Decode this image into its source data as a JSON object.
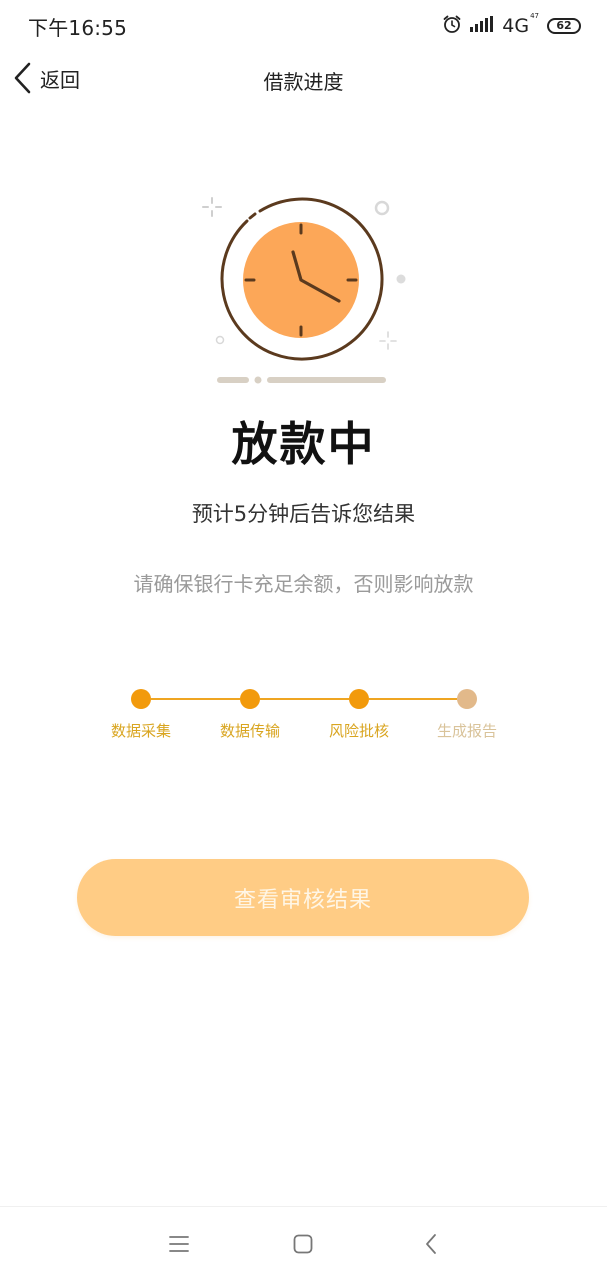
{
  "status_bar": {
    "time": "下午16:55",
    "network": "4G",
    "network_sub": "47",
    "battery": "62"
  },
  "nav": {
    "back_label": "返回",
    "title": "借款进度"
  },
  "status": {
    "title": "放款中",
    "subtitle": "预计5分钟后告诉您结果",
    "hint": "请确保银行卡充足余额，否则影响放款"
  },
  "steps": [
    {
      "label": "数据采集",
      "state": "done"
    },
    {
      "label": "数据传输",
      "state": "done"
    },
    {
      "label": "风险批核",
      "state": "done"
    },
    {
      "label": "生成报告",
      "state": "pending"
    }
  ],
  "actions": {
    "view_result_label": "查看审核结果"
  },
  "colors": {
    "accent": "#f29a0c",
    "clock_fill": "#fca758",
    "clock_ring": "#5b3a1e",
    "button_bg": "#ffcc85",
    "step_pending": "#e2b98a"
  },
  "icons": {
    "alarm": "alarm-icon",
    "signal": "signal-icon",
    "battery": "battery-icon",
    "back": "chevron-left-icon",
    "clock": "clock-icon",
    "menu": "menu-icon",
    "home": "home-icon",
    "system_back": "back-icon"
  }
}
